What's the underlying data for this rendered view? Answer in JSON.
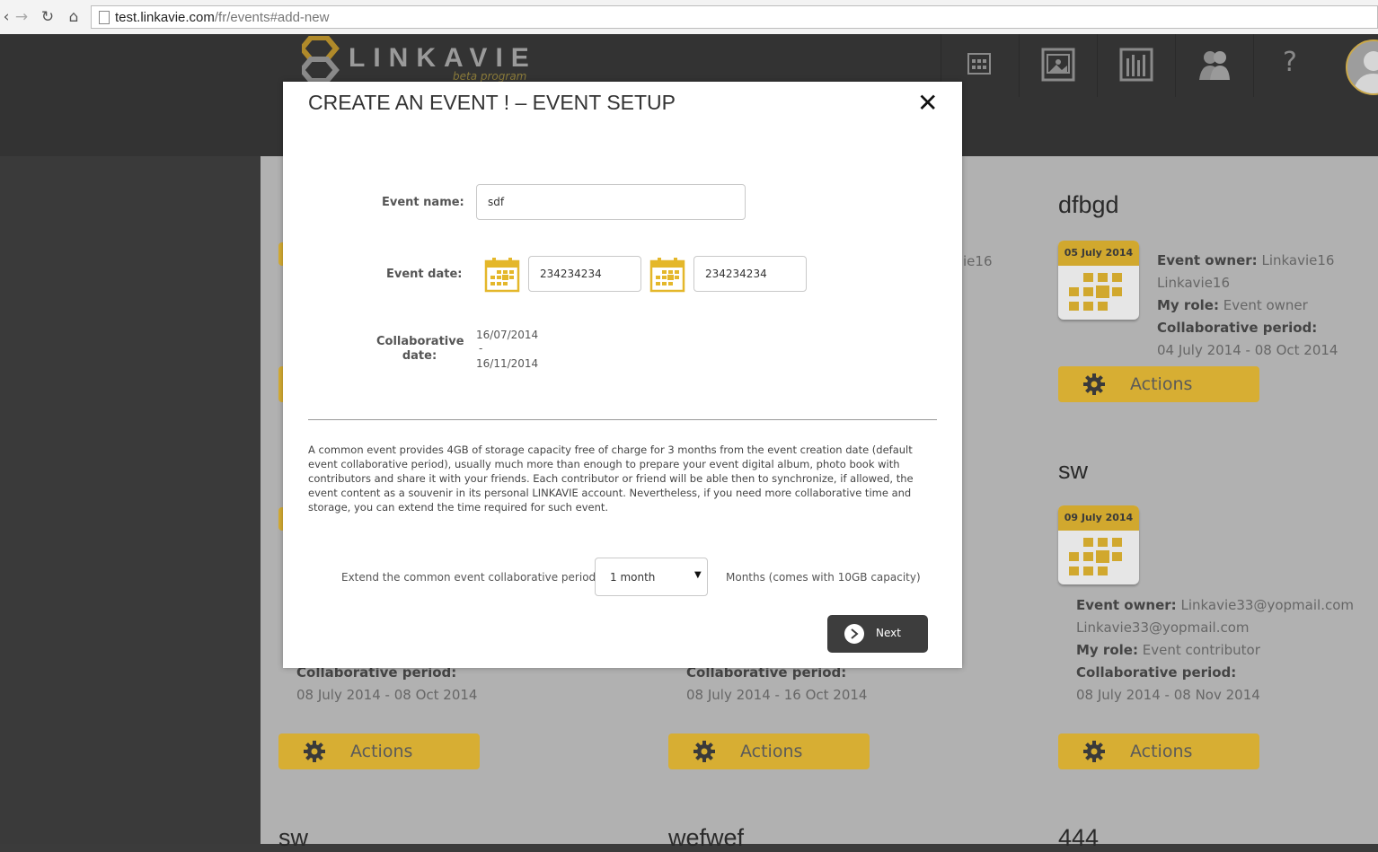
{
  "browser": {
    "url_host": "test.linkavie.com",
    "url_path": "/fr/events#add-new"
  },
  "header": {
    "logo_text": "LINKAVIE",
    "logo_sub": "beta program",
    "help": "?"
  },
  "cards": [
    {
      "title": "dfbgd",
      "date": "05 July 2014",
      "owner_label": "Event owner:",
      "owner": "Linkavie16 Linkavie16",
      "role_label": "My role:",
      "role": "Event owner",
      "period_label": "Collaborative period:",
      "period": "04 July 2014 - 08 Oct 2014",
      "actions": "Actions"
    },
    {
      "title": "sw",
      "date": "09 July 2014",
      "owner_label": "Event owner:",
      "owner": "Linkavie33@yopmail.com",
      "owner2": "Linkavie33@yopmail.com",
      "role_label": "My role:",
      "role": "Event contributor",
      "period_label": "Collaborative period:",
      "period": "08 July 2014 - 08 Nov 2014",
      "actions": "Actions"
    }
  ],
  "bottom_cards": [
    {
      "period_label": "Collaborative period:",
      "period": "08 July 2014 - 08 Oct 2014",
      "actions": "Actions",
      "next_title": "sw"
    },
    {
      "period_label": "Collaborative period:",
      "period": "08 July 2014 - 16 Oct 2014",
      "actions": "Actions",
      "next_title": "wefwef"
    },
    {
      "next_title": "444"
    }
  ],
  "partial_text": "ie16",
  "modal": {
    "title": "CREATE AN EVENT ! – EVENT SETUP",
    "close": "✕",
    "event_name_label": "Event name:",
    "event_name_value": "sdf",
    "event_date_label": "Event date:",
    "start_date_value": "234234234",
    "end_date_value": "234234234",
    "collab_label": "Collaborative date:",
    "collab_start": "16/07/2014",
    "collab_sep": "-",
    "collab_end": "16/11/2014",
    "description": "A common event provides 4GB of storage capacity free of charge for 3 months from the event creation date (default event collaborative period), usually much more than enough to prepare your event digital album, photo book with contributors and share it with your friends. Each contributor or friend will be able then to synchronize, if allowed, the event content as a souvenir in its personal LINKAVIE account. Nevertheless, if you need more collaborative time and storage, you can extend the time required for such event.",
    "extend_label": "Extend the common event collaborative period:",
    "extend_selected": "1 month",
    "extend_note": "Months (comes with 10GB capacity)",
    "next_label": "Next"
  },
  "colors": {
    "accent": "#d7ae33",
    "header": "#333333",
    "backdrop": "#b1b1b1"
  }
}
